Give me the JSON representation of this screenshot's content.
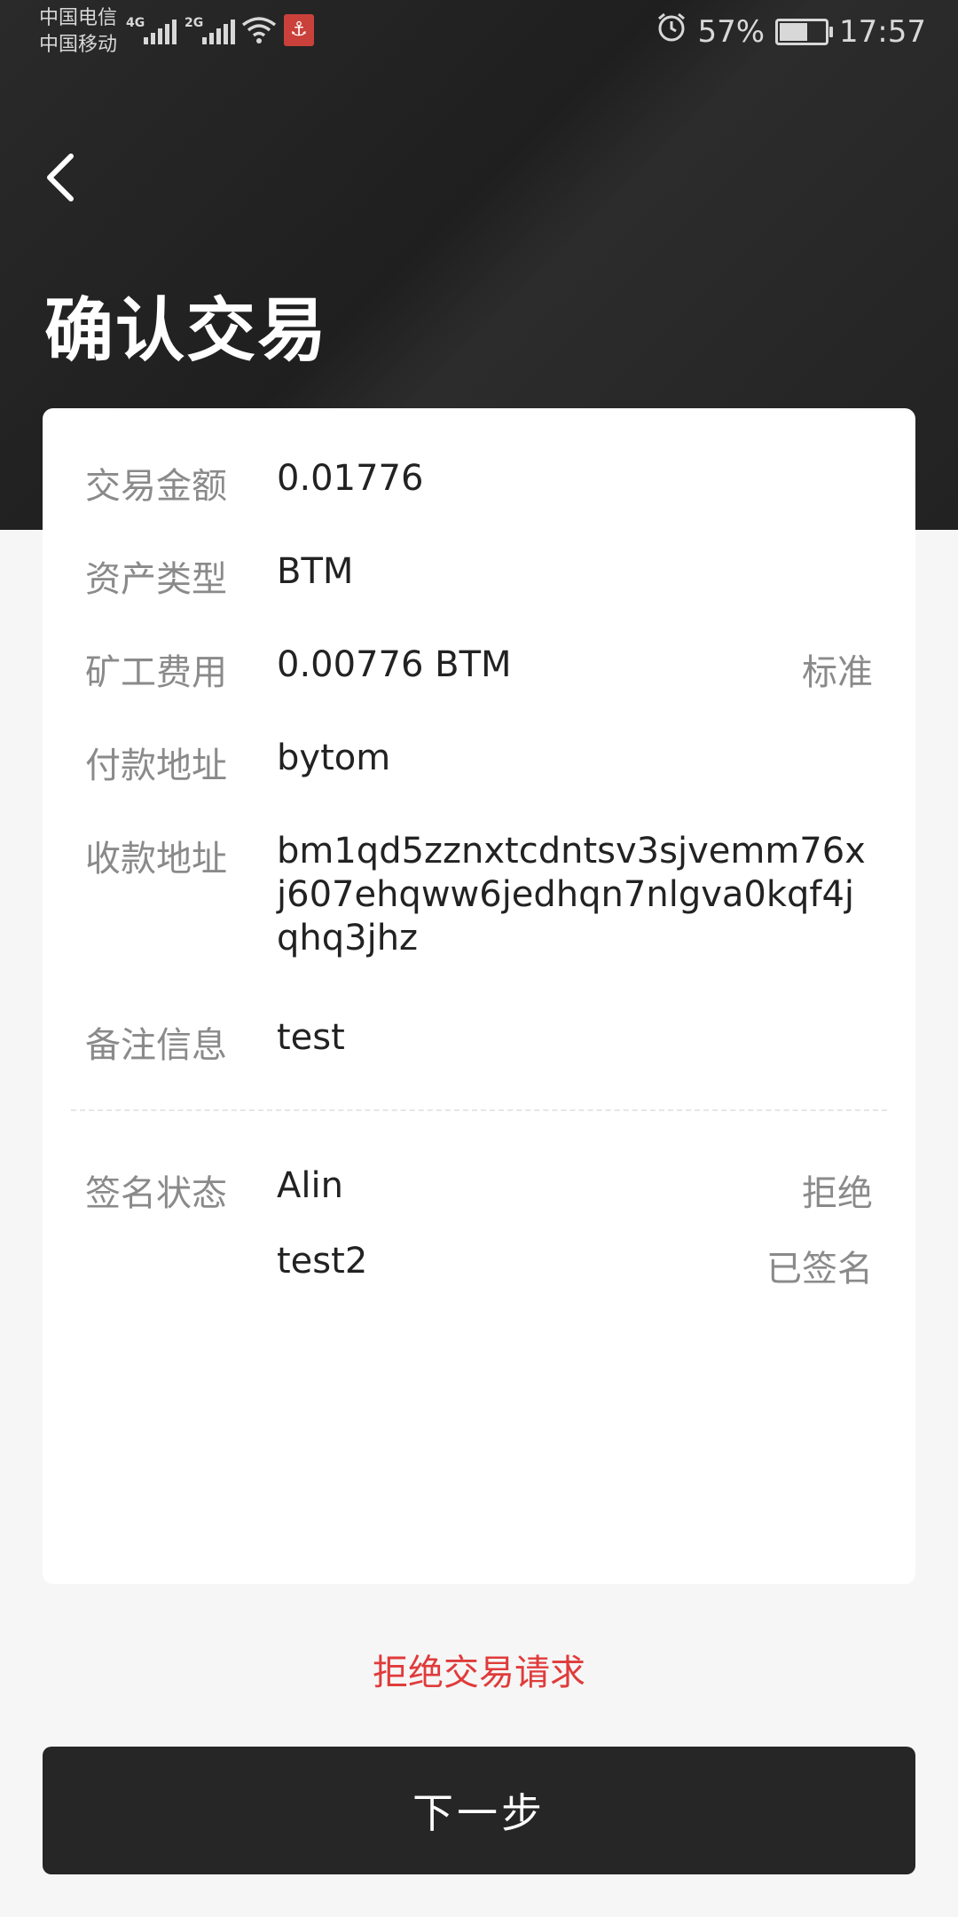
{
  "status_bar": {
    "carrier_1": "中国电信",
    "carrier_2": "中国移动",
    "net_1": "4G",
    "net_2": "2G",
    "battery_percent": "57%",
    "time": "17:57",
    "icons": [
      "signal-icon",
      "wifi-icon",
      "app-notification-icon",
      "alarm-icon",
      "battery-icon"
    ]
  },
  "header": {
    "back_icon": "chevron-left-icon",
    "title": "确认交易"
  },
  "details": [
    {
      "label": "交易金额",
      "value": "0.01776"
    },
    {
      "label": "资产类型",
      "value": "BTM"
    },
    {
      "label": "矿工费用",
      "value": "0.00776 BTM",
      "aside": "标准"
    },
    {
      "label": "付款地址",
      "value": "bytom"
    },
    {
      "label": "收款地址",
      "value": "bm1qd5zznxtcdntsv3sjvemm76xj607ehqww6jedhqn7nlgva0kqf4jqhq3jhz"
    },
    {
      "label": "备注信息",
      "value": "test"
    }
  ],
  "signature": {
    "label": "签名状态",
    "signers": [
      {
        "name": "Alin",
        "status": "拒绝"
      },
      {
        "name": "test2",
        "status": "已签名"
      }
    ]
  },
  "actions": {
    "reject_label": "拒绝交易请求",
    "next_label": "下一步"
  },
  "colors": {
    "header_bg": "#222222",
    "reject_text": "#e03b3b",
    "button_bg": "#262626"
  }
}
